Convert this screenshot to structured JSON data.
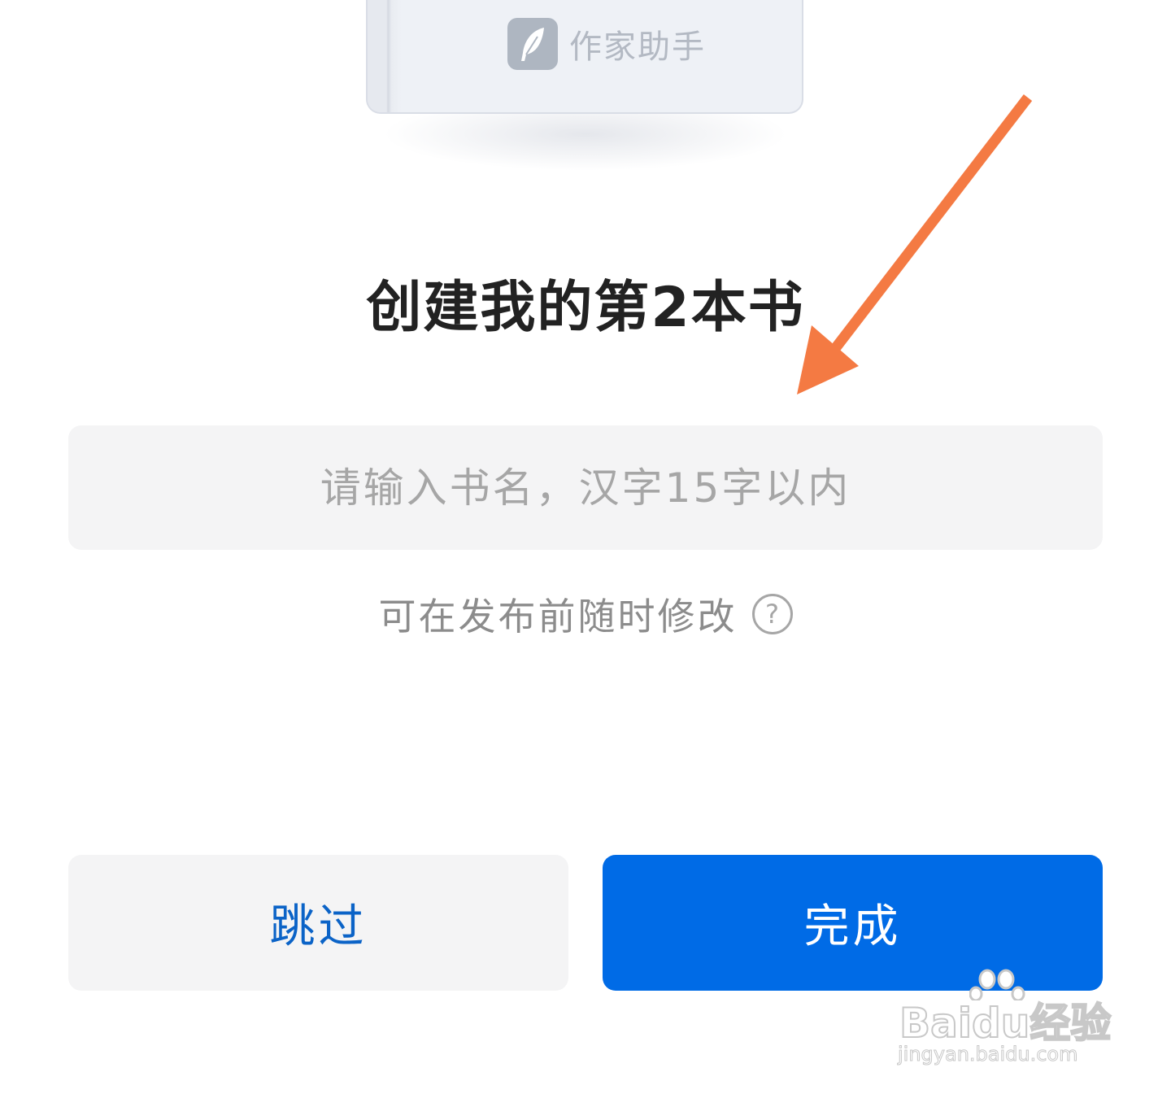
{
  "book": {
    "logo_text": "作家助手",
    "logo_icon": "feather-pen-icon"
  },
  "page": {
    "title": "创建我的第2本书"
  },
  "book_name_input": {
    "placeholder": "请输入书名，汉字15字以内",
    "value": ""
  },
  "hint": {
    "text": "可在发布前随时修改",
    "icon": "help-icon",
    "icon_glyph": "?"
  },
  "actions": {
    "skip_label": "跳过",
    "done_label": "完成"
  },
  "annotation": {
    "arrow_color": "#f47a43"
  },
  "watermark": {
    "main": "Baidu经验",
    "sub": "jingyan.baidu.com"
  },
  "colors": {
    "primary": "#006be6",
    "skip_text": "#0b63c7",
    "input_bg": "#f4f4f5"
  }
}
